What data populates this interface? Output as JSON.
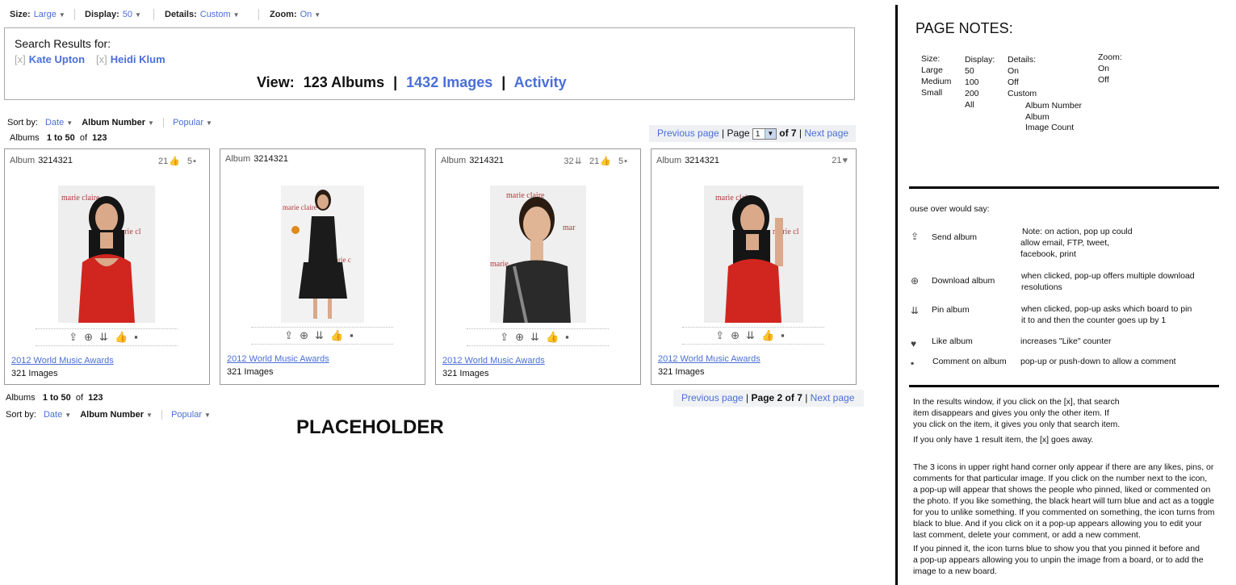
{
  "toolbar": {
    "size": {
      "label": "Size:",
      "value": "Large"
    },
    "display": {
      "label": "Display:",
      "value": "50"
    },
    "details": {
      "label": "Details:",
      "value": "Custom"
    },
    "zoom": {
      "label": "Zoom:",
      "value": "On"
    }
  },
  "search": {
    "header": "Search Results for:",
    "tags": [
      {
        "x": "[x]",
        "name": "Kate Upton"
      },
      {
        "x": "[x]",
        "name": "Heidi Klum"
      }
    ],
    "view_label": "View:",
    "albums": "123 Albums",
    "sep": "|",
    "images": "1432 Images",
    "activity": "Activity"
  },
  "sort": {
    "label": "Sort by:",
    "date": "Date",
    "album_number": "Album Number",
    "popular": "Popular"
  },
  "results_top": {
    "prefix": "Albums",
    "range": "1 to 50",
    "of": "of",
    "total": "123"
  },
  "pager_top": {
    "prev": "Previous page",
    "page_label": "Page",
    "page_value": "1",
    "of": "of 7",
    "next": "Next page"
  },
  "pager_bottom": {
    "prev": "Previous page",
    "page_text": "Page 2 of 7",
    "next": "Next page"
  },
  "cards": [
    {
      "album_label": "Album",
      "album_no": "3214321",
      "likes": "21",
      "comments": "5",
      "title": "2012 World Music Awards",
      "count": "321 Images",
      "dress": "#d1261f"
    },
    {
      "album_label": "Album",
      "album_no": "3214321",
      "title": "2012 World Music Awards",
      "count": "321 Images",
      "dress": "#1b1b1b"
    },
    {
      "album_label": "Album",
      "album_no": "3214321",
      "pins": "32",
      "likes": "21",
      "comments": "5",
      "title": "2012 World Music Awards",
      "count": "321 Images",
      "dress": "#2a2a2a"
    },
    {
      "album_label": "Album",
      "album_no": "3214321",
      "hearts": "21",
      "title": "2012 World Music Awards",
      "count": "321 Images",
      "dress": "#d1261f"
    }
  ],
  "placeholder": "PLACEHOLDER",
  "notes": {
    "title": "PAGE NOTES:",
    "size": {
      "label": "Size:",
      "opts": [
        "Large",
        "Medium",
        "Small"
      ]
    },
    "display": {
      "label": "Display:",
      "opts": [
        "50",
        "100",
        "200",
        "All"
      ]
    },
    "details": {
      "label": "Details:",
      "opts": [
        "On",
        "Off",
        "Custom"
      ],
      "custom_opts": [
        "Album Number",
        "Album",
        "Image Count"
      ]
    },
    "zoom": {
      "label": "Zoom:",
      "opts": [
        "On",
        "Off"
      ]
    },
    "mouseover": "ouse over would say:",
    "actions": [
      {
        "label": "Send  album",
        "desc": [
          "Note: on action, pop up could",
          "allow email, FTP, tweet,",
          "facebook, print"
        ]
      },
      {
        "label": "Download  album",
        "desc": [
          "when clicked, pop-up offers multiple download",
          "resolutions"
        ]
      },
      {
        "label": "Pin  album",
        "desc": [
          "when clicked, pop-up asks which board to pin",
          "it to  and then the counter goes up by 1"
        ]
      },
      {
        "label": "Like  album",
        "desc": [
          "increases \"Like\" counter"
        ]
      },
      {
        "label": "Comment on  album",
        "desc": [
          "pop-up or push-down to allow a comment"
        ]
      }
    ],
    "para1": [
      "In the results window, if you click on the [x], that search",
      "item disappears and gives you only the other item.  If",
      "you click on the item, it gives you only that search item."
    ],
    "para2": "If you only have 1 result item, the [x] goes away.",
    "para3": [
      "The 3 icons in upper right hand corner only appear if there are any likes, pins, or",
      "comments for that particular image.   If you click on the number next to the icon,",
      "a pop-up will appear that shows the people who pinned, liked or commented on",
      "the photo.  If you like something, the black heart will turn blue and act as a toggle",
      "for you to unlike something.  If you commented on something, the icon turns from",
      "black to blue.  And if you click on it a pop-up appears allowing you to edit your",
      "last comment, delete your comment, or add a new comment."
    ],
    "para4": [
      "If you pinned it, the icon turns    blue   to show you that you pinned it before and",
      "a pop-up appears allowing you to unpin the image from a board, or to add the",
      "image to a new board."
    ]
  }
}
